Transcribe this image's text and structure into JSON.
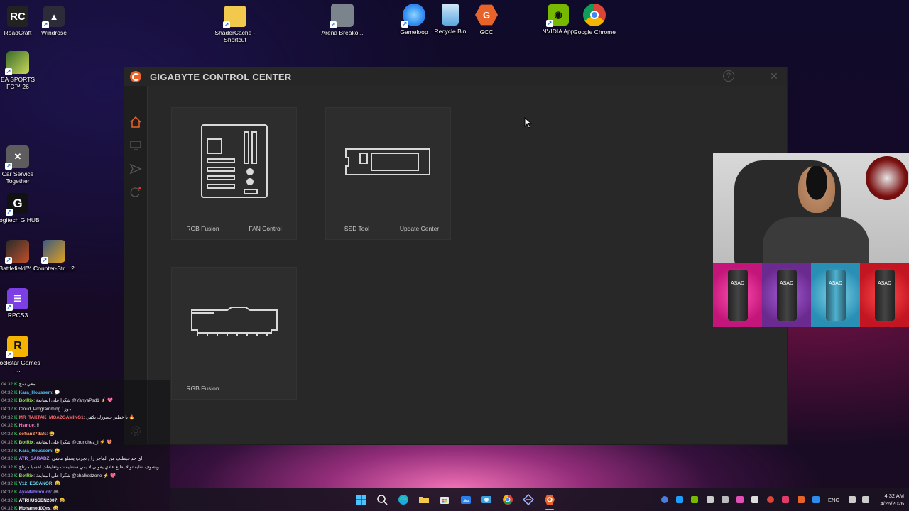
{
  "desktop_icons": [
    {
      "label": "RoadCraft",
      "icon": "roadcraft-icon",
      "color": "#ffffff"
    },
    {
      "label": "Windrose",
      "icon": "windrose-icon",
      "color": "#ffffff"
    },
    {
      "label": "ShaderCache - Shortcut",
      "icon": "folder-icon",
      "color": "#f2c94c"
    },
    {
      "label": "Arena Breako...",
      "icon": "arena-breakout-icon",
      "color": "#7b848c"
    },
    {
      "label": "Gameloop",
      "icon": "gameloop-icon",
      "color": "#2d8cf0"
    },
    {
      "label": "Recycle Bin",
      "icon": "recycle-bin-icon",
      "color": "#5aa7e0"
    },
    {
      "label": "GCC",
      "icon": "gcc-icon",
      "color": "#e8632a"
    },
    {
      "label": "NVIDIA App",
      "icon": "nvidia-icon",
      "color": "#76b900"
    },
    {
      "label": "Google Chrome",
      "icon": "chrome-icon",
      "color": "#db4437"
    },
    {
      "label": "EA SPORTS FC™ 26",
      "icon": "ea-fc-icon",
      "color": "#5a8a3a"
    },
    {
      "label": "Car Service Together",
      "icon": "car-service-icon",
      "color": "#8a8a8a"
    },
    {
      "label": "Logitech G HUB",
      "icon": "logitech-icon",
      "color": "#111111"
    },
    {
      "label": "Battlefield™ 6",
      "icon": "battlefield-icon",
      "color": "#c0502a"
    },
    {
      "label": "Counter-Str... 2",
      "icon": "counter-strike-icon",
      "color": "#e0a020"
    },
    {
      "label": "RPCS3",
      "icon": "rpcs3-icon",
      "color": "#7b3fe4"
    },
    {
      "label": "Rockstar Games ...",
      "icon": "rockstar-icon",
      "color": "#f4b400"
    }
  ],
  "window": {
    "title": "GIGABYTE CONTROL CENTER",
    "help": "?",
    "minimize": "–",
    "close": "✕"
  },
  "sidebar": [
    "home-icon",
    "monitor-icon",
    "send-icon",
    "update-icon",
    "settings-icon"
  ],
  "cards": [
    {
      "device": "motherboard",
      "links": [
        "RGB Fusion",
        "FAN Control"
      ]
    },
    {
      "device": "ssd",
      "links": [
        "SSD Tool",
        "Update Center"
      ]
    },
    {
      "device": "memory",
      "links": [
        "RGB Fusion",
        ""
      ]
    }
  ],
  "chat": [
    {
      "time": "04:32",
      "user": "",
      "color": "#cccccc",
      "text": "معي سح"
    },
    {
      "time": "04:32",
      "user": "Kara_Houssem",
      "color": "#4fc3f7",
      "text": ": 💬"
    },
    {
      "time": "04:32",
      "user": "BotRix",
      "color": "#9be15d",
      "text": ": شكرا على المتابعة @YahyaPsd1 ⚡ 💖"
    },
    {
      "time": "04:32",
      "user": "",
      "color": "#f5a623",
      "text": "Cloud_Programming : موز"
    },
    {
      "time": "04:32",
      "user": "MR_TAKTAK_MOAZGAMING1",
      "color": "#ff6b6b",
      "text": ": يا خطير حضورك يكفي 🔥"
    },
    {
      "time": "04:32",
      "user": "Hsmue",
      "color": "#ff79c6",
      "text": ": !!"
    },
    {
      "time": "04:32",
      "user": "sofian87dafs",
      "color": "#ff9966",
      "text": ": 😀"
    },
    {
      "time": "04:32",
      "user": "BotRix",
      "color": "#9be15d",
      "text": ": شكرا على المتابعة @crunchez_l ⚡ 💖"
    },
    {
      "time": "04:32",
      "user": "Kara_Houssem",
      "color": "#4fc3f7",
      "text": ": 😀"
    },
    {
      "time": "04:32",
      "user": "ATR_SARADZ",
      "color": "#b18cff",
      "text": ": اي حد حيطلب من الماجر راح نجرب يعملو ماشي"
    },
    {
      "time": "04:32",
      "user": "",
      "color": "#cccccc",
      "text": "ويشوف نعليقاتو لا يطلع عادي يقولي لا يمي سنعليقات وتعليقات لقسيا مرتاح"
    },
    {
      "time": "04:32",
      "user": "BotRix",
      "color": "#9be15d",
      "text": ": شكرا على المتابعة @chalkedzone ⚡ 💖"
    },
    {
      "time": "04:32",
      "user": "V12_ESCANOR",
      "color": "#66d9ef",
      "text": ": 😀"
    },
    {
      "time": "04:32",
      "user": "AyaMahmoud6",
      "color": "#8a7cff",
      "text": ": 🎮"
    },
    {
      "time": "04:32",
      "user": "ATRHUSSEN2007",
      "color": "#ffffff",
      "text": ": 😀"
    },
    {
      "time": "04:32",
      "user": "Mohamed0Qrs",
      "color": "#ffffff",
      "text": ": 😀"
    }
  ],
  "taskbar": {
    "apps": [
      "windows-start-icon",
      "search-icon",
      "edge-icon",
      "file-explorer-icon",
      "store-icon",
      "photos-icon",
      "snipping-icon",
      "chrome-icon",
      "vpn-icon",
      "gcc-icon"
    ],
    "lang": "ENG",
    "time": "4:32 AM",
    "date": "4/26/2026"
  },
  "cans": [
    {
      "color": "#c4167a",
      "label": "ASAD"
    },
    {
      "color": "#6b2a8f",
      "label": "ASAD"
    },
    {
      "color": "#2a8fb5",
      "label": "ASAD"
    },
    {
      "color": "#c41622",
      "label": "ASAD"
    }
  ]
}
